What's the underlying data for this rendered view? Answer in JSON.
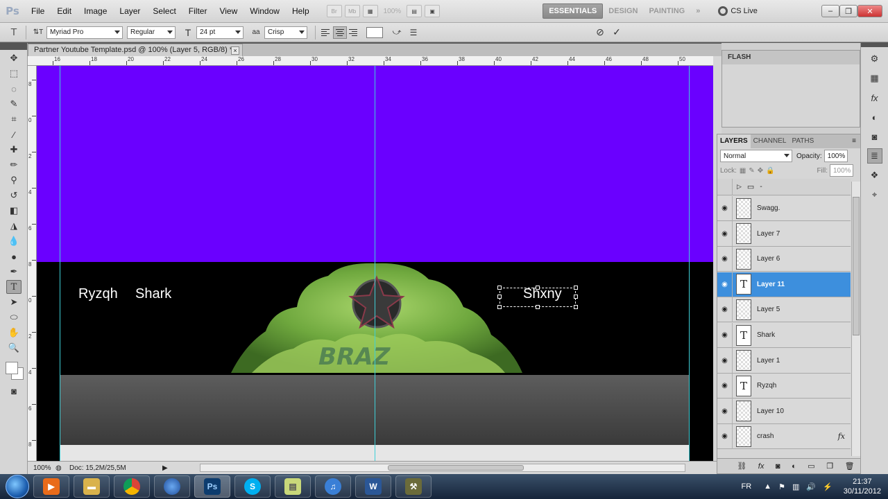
{
  "app": {
    "logo": "Ps"
  },
  "menu": [
    "File",
    "Edit",
    "Image",
    "Layer",
    "Select",
    "Filter",
    "View",
    "Window",
    "Help"
  ],
  "menubar": {
    "zoom": "100%"
  },
  "workspaces": {
    "active": "ESSENTIALS",
    "others": [
      "DESIGN",
      "PAINTING"
    ],
    "more": "»"
  },
  "cslive": "CS Live",
  "window_controls": {
    "minimize": "–",
    "restore": "❐",
    "close": "✕"
  },
  "options": {
    "tool_icon": "T",
    "orient_icon": "⇅T",
    "font_family": "Myriad Pro",
    "font_style": "Regular",
    "size_icon": "T",
    "font_size": "24 pt",
    "aa_icon": "aa",
    "anti_alias": "Crisp",
    "cancel_icon": "⊘",
    "commit_icon": "✓"
  },
  "document": {
    "tab_title": "Partner Youtube Template.psd @ 100% (Layer 5, RGB/8) *",
    "tab_close": "×",
    "ruler_h_labels": [
      "16",
      "18",
      "20",
      "22",
      "24",
      "26",
      "28",
      "30",
      "32",
      "34",
      "36",
      "38",
      "40",
      "42",
      "44",
      "46",
      "48",
      "50"
    ],
    "ruler_v_labels": [
      "8",
      "0",
      "2",
      "4",
      "6",
      "8",
      "0",
      "2",
      "4",
      "6",
      "8"
    ],
    "canvas_texts": {
      "ryzqh": "Ryzqh",
      "shark": "Shark",
      "editing": "Shxny"
    },
    "colors": {
      "sky": "#6a00ff",
      "ground": "#000000",
      "guides": "#3fd0d8"
    }
  },
  "status": {
    "zoom": "100%",
    "doc": "Doc: 15,2M/25,5M"
  },
  "panels": {
    "flash_tab": "FLASH",
    "layer_tabs": [
      "LAYERS",
      "CHANNEL",
      "PATHS"
    ],
    "blend_mode": "Normal",
    "opacity_label": "Opacity:",
    "opacity": "100%",
    "lock_label": "Lock:",
    "fill_label": "Fill:",
    "fill": "100%",
    "group_name": "-",
    "layers": [
      {
        "name": "Swagg.",
        "type": "pixel",
        "fx": ""
      },
      {
        "name": "Layer 7",
        "type": "pixel",
        "fx": ""
      },
      {
        "name": "Layer 6",
        "type": "pixel",
        "fx": ""
      },
      {
        "name": "Layer 11",
        "type": "text",
        "fx": "",
        "selected": true
      },
      {
        "name": "Layer 5",
        "type": "pixel",
        "fx": ""
      },
      {
        "name": "Shark",
        "type": "text",
        "fx": ""
      },
      {
        "name": "Layer 1",
        "type": "pixel",
        "fx": ""
      },
      {
        "name": "Ryzqh",
        "type": "text",
        "fx": ""
      },
      {
        "name": "Layer 10",
        "type": "pixel",
        "fx": ""
      },
      {
        "name": "crash",
        "type": "pixel",
        "fx": "fx"
      }
    ]
  },
  "taskbar": {
    "apps": [
      "media-player",
      "explorer",
      "chrome",
      "firefox",
      "photoshop",
      "skype",
      "notes",
      "itunes",
      "word",
      "tools"
    ],
    "ps_label": "Ps",
    "word_label": "W",
    "language": "FR",
    "time": "21:37",
    "date": "30/11/2012"
  }
}
